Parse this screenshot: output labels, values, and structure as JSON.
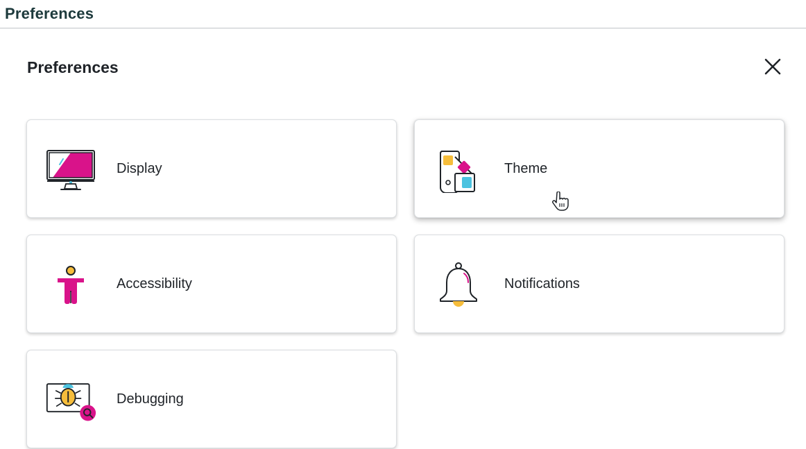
{
  "page_header": {
    "title": "Preferences"
  },
  "dialog": {
    "title": "Preferences",
    "close_icon": "close-icon"
  },
  "cards": [
    {
      "id": "display",
      "label": "Display",
      "icon": "monitor-icon"
    },
    {
      "id": "theme",
      "label": "Theme",
      "icon": "color-swatch-icon"
    },
    {
      "id": "accessibility",
      "label": "Accessibility",
      "icon": "accessibility-person-icon"
    },
    {
      "id": "notifications",
      "label": "Notifications",
      "icon": "bell-icon"
    },
    {
      "id": "debugging",
      "label": "Debugging",
      "icon": "bug-magnifier-icon"
    }
  ],
  "hovered_card": "theme",
  "colors": {
    "magenta": "#d9138a",
    "yellow": "#f6bd3b",
    "cyan": "#4cc3e0",
    "outline": "#1f2328",
    "header_text": "#1d3a3c"
  }
}
